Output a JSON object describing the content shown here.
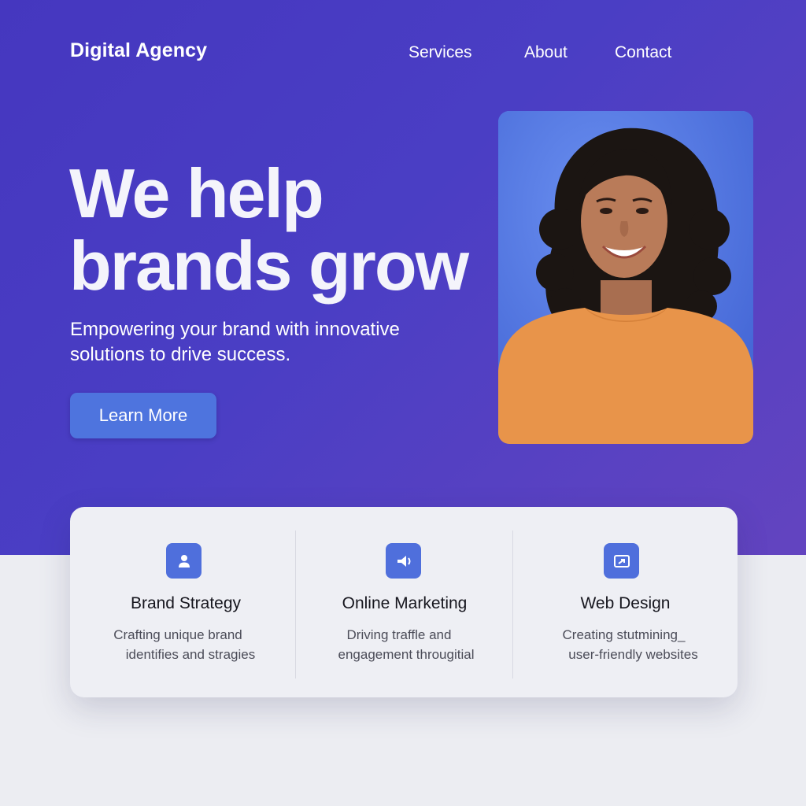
{
  "header": {
    "brand": "Digital Agency",
    "nav": [
      {
        "label": "Services"
      },
      {
        "label": "About"
      },
      {
        "label": "Contact"
      }
    ]
  },
  "hero": {
    "headline_lines": [
      "We help",
      "brands grow"
    ],
    "subtitle_lines": [
      "Empowering your brand with innovative",
      "solutions to drive success."
    ],
    "cta_label": "Learn More"
  },
  "features": [
    {
      "icon": "user-icon",
      "title": "Brand Strategy",
      "desc_lines": [
        "Crafting unique brand",
        "identifies and stragies"
      ]
    },
    {
      "icon": "megaphone-icon",
      "title": "Online Marketing",
      "desc_lines": [
        "Driving traffle and",
        "engagement througitial"
      ]
    },
    {
      "icon": "browser-icon",
      "title": "Web Design",
      "desc_lines": [
        "Creating stutmining_",
        "user-friendly websites"
      ]
    }
  ],
  "colors": {
    "hero_bg": "#4a3ec4",
    "accent": "#4f6fdc",
    "page_bg": "#ecedf2"
  }
}
